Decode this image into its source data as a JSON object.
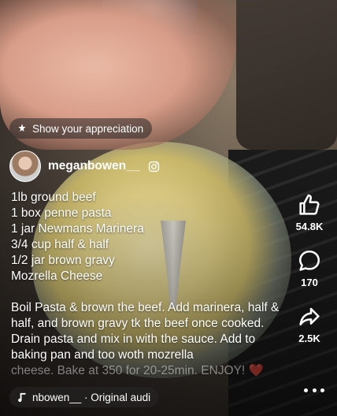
{
  "appreciation": {
    "label": "Show your appreciation",
    "icon": "sparkle-icon"
  },
  "author": {
    "username": "meganbowen__",
    "badge_icon": "instagram-icon"
  },
  "caption": {
    "lines": [
      "1lb ground beef",
      "1 box penne pasta",
      "1 jar Newmans Marinera",
      "3/4 cup half & half",
      "1/2 jar brown gravy",
      "Mozrella Cheese"
    ],
    "instructions": "Boil Pasta & brown the beef. Add marinera, half & half, and brown gravy tk the beef once cooked. Drain pasta and mix in with the sauce. Add to baking pan and too woth mozrella",
    "truncated_line": "cheese. Bake at 350 for 20-25min. ENJOY! ❤️"
  },
  "actions": {
    "like": {
      "icon": "thumbs-up-icon",
      "count": "54.8K"
    },
    "comment": {
      "icon": "comment-bubble-icon",
      "count": "170"
    },
    "share": {
      "icon": "share-arrow-icon",
      "count": "2.5K"
    },
    "more": {
      "icon": "more-dots-icon"
    }
  },
  "audio": {
    "icon": "music-note-icon",
    "label": "nbowen__ · Original audi"
  }
}
